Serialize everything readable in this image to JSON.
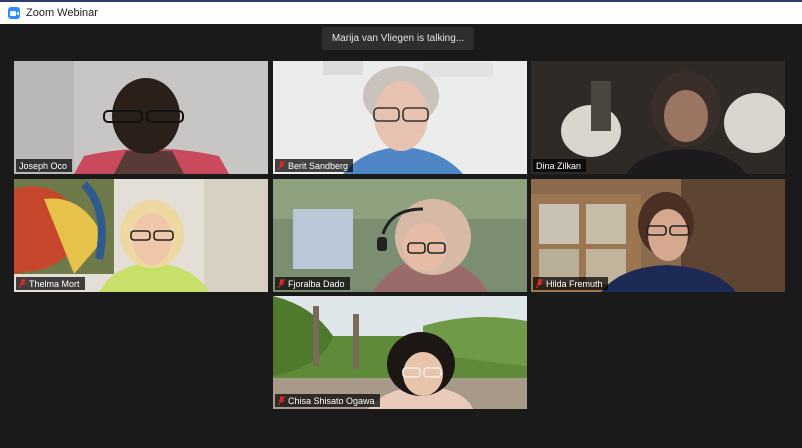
{
  "window": {
    "title": "Zoom Webinar",
    "icon": "zoom-camera-icon",
    "accent": "#2d8cff"
  },
  "banner": {
    "talking": "Marija van Vliegen is talking..."
  },
  "participants": [
    {
      "name": "Joseph Oco",
      "muted": false
    },
    {
      "name": "Berit Sandberg",
      "muted": true
    },
    {
      "name": "Dina Zilkan",
      "muted": false
    },
    {
      "name": "Thelma Mort",
      "muted": true
    },
    {
      "name": "Fjoralba Dado",
      "muted": true
    },
    {
      "name": "Hilda Fremuth",
      "muted": true
    },
    {
      "name": "Chisa Shisato Ogawa",
      "muted": true
    }
  ],
  "colors": {
    "background": "#1a1a1a",
    "nameplate": "rgba(0,0,0,0.72)",
    "muted_icon": "#e02828"
  }
}
